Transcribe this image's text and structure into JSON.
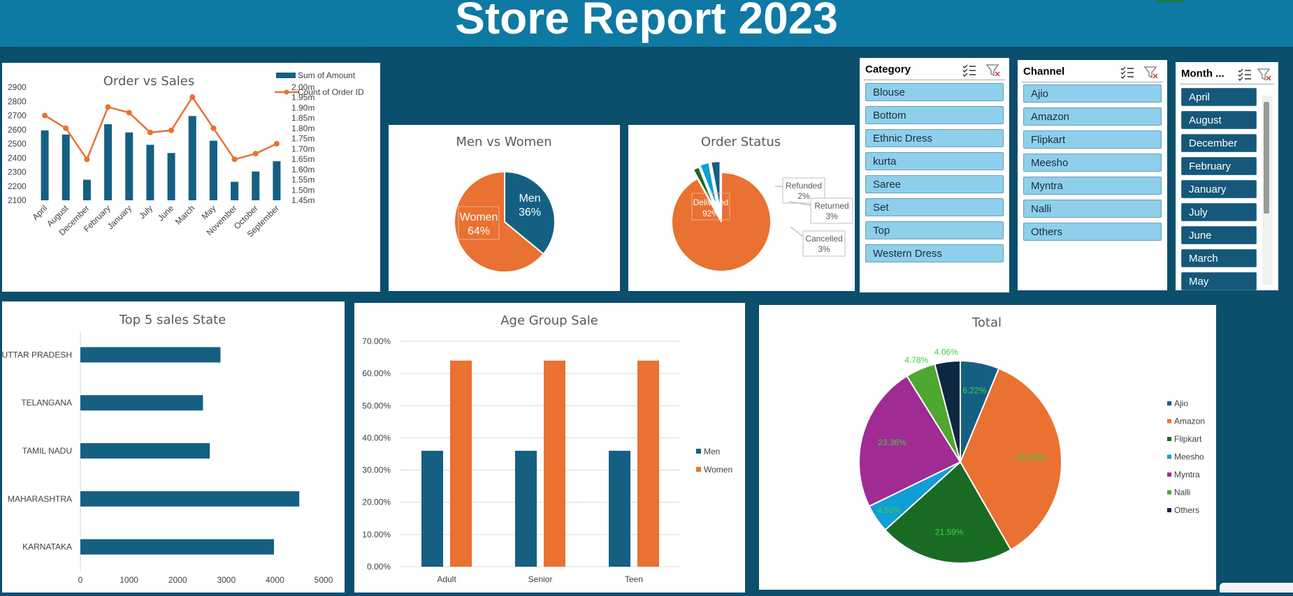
{
  "page": {
    "title": "Store Report 2023"
  },
  "colors": {
    "primary": "#156082",
    "accent": "#e97132",
    "bg": "#0b4f6c",
    "header": "#0e79a3"
  },
  "icons": {
    "multi_select": "multi-select-icon",
    "clear_filter": "clear-filter-icon"
  },
  "chart_data": [
    {
      "id": "order-vs-sales",
      "type": "bar",
      "title": "Order vs Sales",
      "categories": [
        "April",
        "August",
        "December",
        "February",
        "January",
        "July",
        "June",
        "March",
        "May",
        "November",
        "October",
        "September"
      ],
      "series": [
        {
          "name": "Sum of Amount",
          "type": "bar",
          "axis": "secondary",
          "values": [
            1.79,
            1.77,
            1.55,
            1.82,
            1.78,
            1.72,
            1.68,
            1.86,
            1.74,
            1.54,
            1.59,
            1.64
          ]
        },
        {
          "name": "Count of Order ID",
          "type": "line",
          "axis": "primary",
          "values": [
            2700,
            2610,
            2390,
            2760,
            2720,
            2580,
            2595,
            2830,
            2610,
            2390,
            2430,
            2500
          ]
        }
      ],
      "y_ticks": [
        "2900",
        "2800",
        "2700",
        "2600",
        "2500",
        "2400",
        "2300",
        "2200",
        "2100"
      ],
      "ylim": [
        2100,
        2900
      ],
      "y2_ticks": [
        "2.00m",
        "1.95m",
        "1.90m",
        "1.85m",
        "1.80m",
        "1.75m",
        "1.70m",
        "1.65m",
        "1.60m",
        "1.55m",
        "1.50m",
        "1.45m"
      ],
      "y2lim": [
        1.45,
        2.0
      ],
      "legend": "top-right"
    },
    {
      "id": "men-vs-women",
      "type": "pie",
      "title": "Men vs Women",
      "slices": [
        {
          "label": "Men",
          "pct_label": "36%",
          "value": 36,
          "color": "#156082"
        },
        {
          "label": "Women",
          "pct_label": "64%",
          "value": 64,
          "color": "#e97132"
        }
      ]
    },
    {
      "id": "order-status",
      "type": "pie",
      "title": "Order Status",
      "slices": [
        {
          "label": "Delivered",
          "pct_label": "92%",
          "value": 92,
          "color": "#e97132"
        },
        {
          "label": "Refunded",
          "pct_label": "2%",
          "value": 2,
          "color": "#196b24"
        },
        {
          "label": "Returned",
          "pct_label": "3%",
          "value": 3,
          "color": "#0f9ed5"
        },
        {
          "label": "Cancelled",
          "pct_label": "3%",
          "value": 3,
          "color": "#156082"
        }
      ]
    },
    {
      "id": "top5-states",
      "type": "bar",
      "orientation": "horizontal",
      "title": "Top 5 sales State",
      "categories": [
        "UTTAR PRADESH",
        "TELANGANA",
        "TAMIL NADU",
        "MAHARASHTRA",
        "KARNATAKA"
      ],
      "values": [
        2880,
        2520,
        2660,
        4500,
        3980
      ],
      "x_ticks": [
        "0",
        "1000",
        "2000",
        "3000",
        "4000",
        "5000"
      ],
      "xlim": [
        0,
        5000
      ]
    },
    {
      "id": "age-group-sale",
      "type": "bar",
      "title": "Age Group Sale",
      "categories": [
        "Adult",
        "Senior",
        "Teen"
      ],
      "series": [
        {
          "name": "Men",
          "values": [
            0.36,
            0.36,
            0.36
          ],
          "color": "#156082"
        },
        {
          "name": "Women",
          "values": [
            0.64,
            0.64,
            0.64
          ],
          "color": "#e97132"
        }
      ],
      "y_ticks": [
        "0.00%",
        "10.00%",
        "20.00%",
        "30.00%",
        "40.00%",
        "50.00%",
        "60.00%",
        "70.00%"
      ],
      "ylim": [
        0,
        0.7
      ],
      "legend": "right"
    },
    {
      "id": "total",
      "type": "pie",
      "title": "Total",
      "slices": [
        {
          "label": "Ajio",
          "pct_label": "6.22%",
          "value": 6.22,
          "color": "#156082"
        },
        {
          "label": "Amazon",
          "pct_label": "35.48%",
          "value": 35.48,
          "color": "#e97132"
        },
        {
          "label": "Flipkart",
          "pct_label": "21.59%",
          "value": 21.59,
          "color": "#196b24"
        },
        {
          "label": "Meesho",
          "pct_label": "4.50%",
          "value": 4.5,
          "color": "#0f9ed5"
        },
        {
          "label": "Myntra",
          "pct_label": "23.36%",
          "value": 23.36,
          "color": "#a02b93"
        },
        {
          "label": "Nalli",
          "pct_label": "4.78%",
          "value": 4.78,
          "color": "#4ea72e"
        },
        {
          "label": "Others",
          "pct_label": "4.06%",
          "value": 4.06,
          "color": "#0e2841"
        }
      ],
      "legend": "right"
    }
  ],
  "slicers": {
    "category": {
      "title": "Category",
      "items": [
        "Blouse",
        "Bottom",
        "Ethnic Dress",
        "kurta",
        "Saree",
        "Set",
        "Top",
        "Western Dress"
      ]
    },
    "channel": {
      "title": "Channel",
      "items": [
        "Ajio",
        "Amazon",
        "Flipkart",
        "Meesho",
        "Myntra",
        "Nalli",
        "Others"
      ]
    },
    "month": {
      "title": "Month ...",
      "items": [
        "April",
        "August",
        "December",
        "February",
        "January",
        "July",
        "June",
        "March",
        "May"
      ]
    }
  }
}
